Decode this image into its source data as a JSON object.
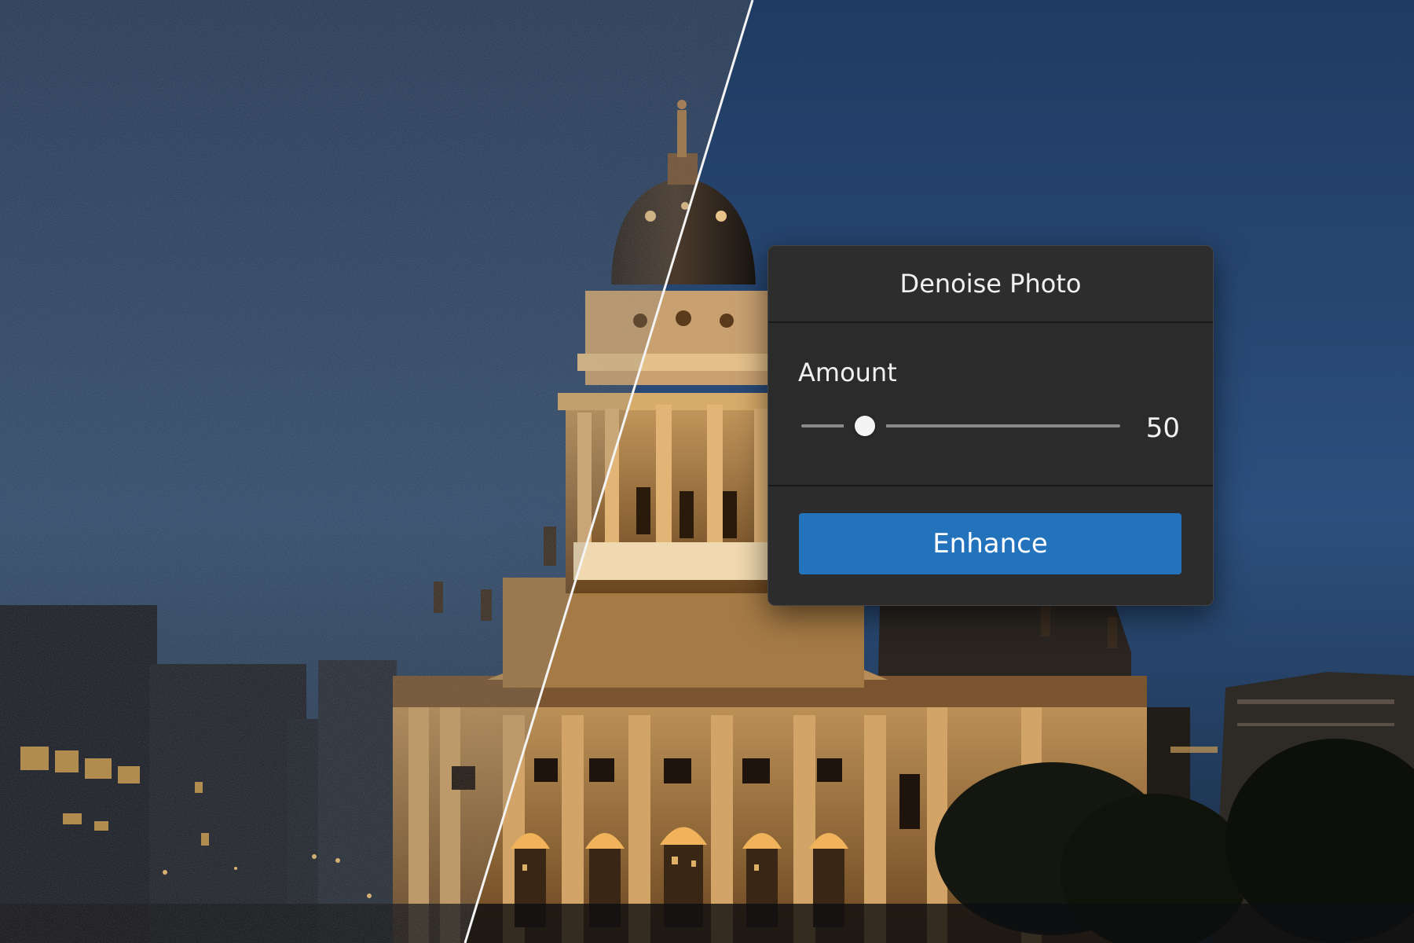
{
  "photo": {
    "description_hidden": false,
    "sky_color": "#2a4a74",
    "building_light": "#d8954a"
  },
  "panel": {
    "title": "Denoise Photo",
    "amount_label": "Amount",
    "amount_value": "50",
    "amount_fraction": 0.2,
    "enhance_label": "Enhance",
    "accent_color": "#2372bc"
  }
}
